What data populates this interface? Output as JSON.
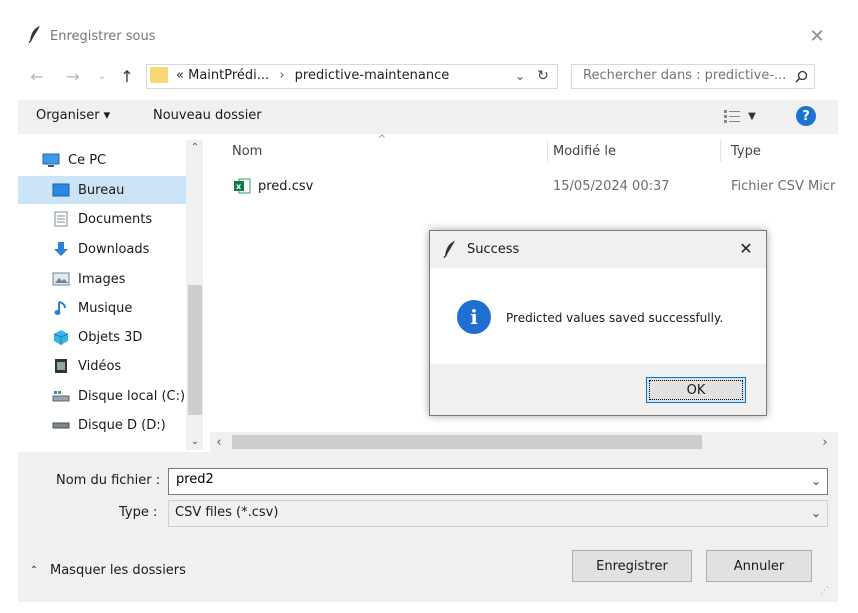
{
  "window": {
    "title": "Enregistrer sous",
    "close": "✕"
  },
  "address": {
    "path_prefix": "«",
    "path_parent": "MaintPrédi...",
    "path_sep": "›",
    "path_current": "predictive-maintenance"
  },
  "search": {
    "placeholder": "Rechercher dans : predictive-..."
  },
  "toolbar": {
    "organize_label": "Organiser ▾",
    "new_folder_label": "Nouveau dossier",
    "help": "?"
  },
  "sidebar": {
    "items": [
      {
        "label": "Ce PC",
        "icon": "pc-icon"
      },
      {
        "label": "Bureau",
        "icon": "desktop-icon",
        "selected": true
      },
      {
        "label": "Documents",
        "icon": "documents-icon"
      },
      {
        "label": "Downloads",
        "icon": "downloads-icon"
      },
      {
        "label": "Images",
        "icon": "images-icon"
      },
      {
        "label": "Musique",
        "icon": "music-icon"
      },
      {
        "label": "Objets 3D",
        "icon": "objects3d-icon"
      },
      {
        "label": "Vidéos",
        "icon": "videos-icon"
      },
      {
        "label": "Disque local (C:)",
        "icon": "drive-c-icon"
      },
      {
        "label": "Disque D (D:)",
        "icon": "drive-d-icon"
      }
    ]
  },
  "files": {
    "columns": [
      "Nom",
      "Modifié le",
      "Type"
    ],
    "rows": [
      {
        "name": "pred.csv",
        "modified": "15/05/2024 00:37",
        "type": "Fichier CSV Micr"
      }
    ]
  },
  "form": {
    "filename_label": "Nom du fichier :",
    "filename_value": "pred2",
    "type_label": "Type :",
    "type_value": "CSV files (*.csv)"
  },
  "footer": {
    "hide_folders_label": "Masquer les dossiers",
    "save_label": "Enregistrer",
    "cancel_label": "Annuler"
  },
  "dialog": {
    "title": "Success",
    "message": "Predicted values saved successfully.",
    "ok_label": "OK",
    "close": "✕",
    "info_glyph": "i"
  },
  "colors": {
    "accent": "#0078d7",
    "selected": "#cce4f7",
    "info_blue": "#1e6fd0",
    "folder": "#f8d775"
  }
}
